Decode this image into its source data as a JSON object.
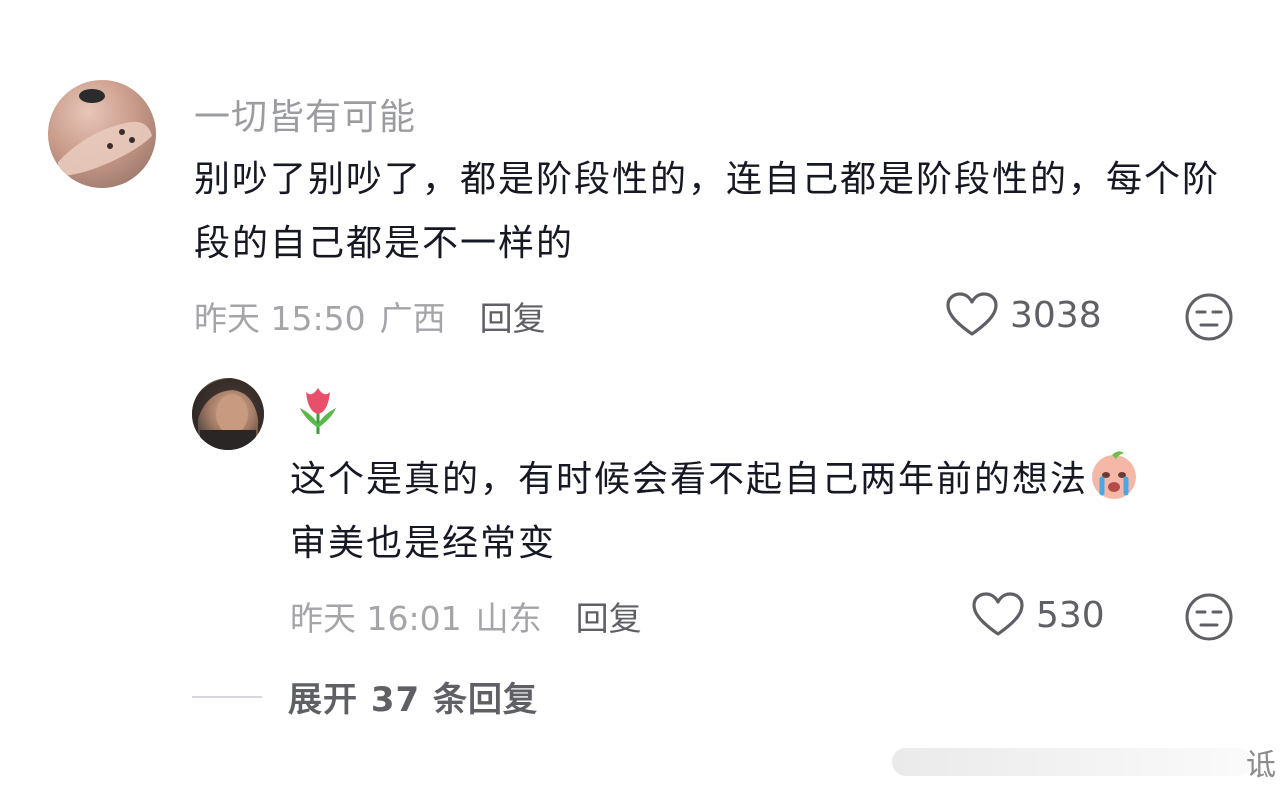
{
  "comment": {
    "username": "一切皆有可能",
    "text": "别吵了别吵了，都是阶段性的，连自己都是阶段性的，每个阶段的自己都是不一样的",
    "time": "昨天 15:50",
    "location": "广西",
    "reply_label": "回复",
    "like_count": "3038",
    "icons": {
      "avatar": "user-avatar",
      "like": "heart-icon",
      "dislike": "dislike-face-icon"
    }
  },
  "reply": {
    "username_icon": "tulip-emoji",
    "text_line1": "这个是真的，有时候会看不起自己两年前的想法",
    "text_line1_emoji": "crying-face-emoji",
    "text_line2": "审美也是经常变",
    "time": "昨天 16:01",
    "location": "山东",
    "reply_label": "回复",
    "like_count": "530"
  },
  "expand": {
    "label": "展开 37 条回复"
  },
  "watermark": {
    "text": "诋"
  },
  "colors": {
    "text_primary": "#161823",
    "text_secondary": "#a4a5a8",
    "text_action": "#5f6066"
  }
}
